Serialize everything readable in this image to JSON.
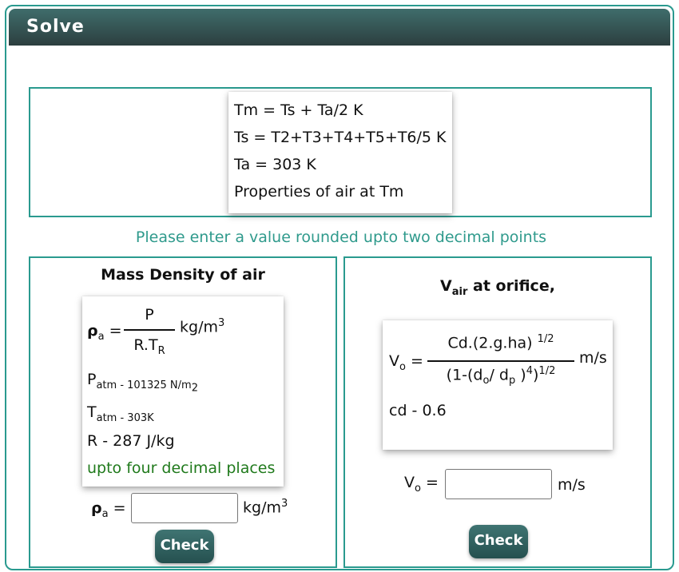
{
  "header": {
    "title": "Solve"
  },
  "formulas": {
    "line1": "Tm = Ts + Ta/2 K",
    "line2": "Ts = T2+T3+T4+T5+T6/5 K",
    "line3": "Ta = 303 K",
    "line4": "Properties of air at Tm"
  },
  "instruction": "Please enter a value rounded upto two decimal points",
  "left_panel": {
    "title": "Mass Density of air",
    "rho_symbol": "ρ",
    "rho_sub": "a",
    "equals": "=",
    "num": "P",
    "den_main": "R.T",
    "den_sub": "R",
    "unit_main": "kg/m",
    "unit_sup": "3",
    "patm_main": "P",
    "patm_sub": "atm - 101325 N/m",
    "patm_sub2": "2",
    "tatm_main": "T",
    "tatm_sub": "atm - 303K",
    "r_line": "R - 287 J/kg",
    "note": "upto four decimal places",
    "input_label_symbol": "ρ",
    "input_label_sub": "a",
    "input_label_eq": "=",
    "input_unit": "kg/m",
    "input_unit_sup": "3",
    "input_value": "",
    "check_label": "Check"
  },
  "right_panel": {
    "title_main": "V",
    "title_sub": "air",
    "title_rest": " at orifice,",
    "vo_main": "V",
    "vo_sub": "o",
    "equals": "=",
    "num": "Cd.(2.g.ha)",
    "num_sup": "1/2",
    "den_a": "(1-(d",
    "den_sub_o": "o",
    "den_b": "/ d",
    "den_sub_p": "p",
    "den_c": ")",
    "den_sup4": "4",
    "den_d": ")",
    "den_sup": "1/2",
    "unit": "m/s",
    "cd_line": "cd - 0.6",
    "input_label_main": "V",
    "input_label_sub": "o",
    "input_label_eq": "=",
    "input_unit": "m/s",
    "input_value": "",
    "check_label": "Check"
  },
  "colors": {
    "accent": "#2a9a8f",
    "instruction": "#2f9a8c",
    "note": "#207a1c",
    "header_top": "#3f6d6b",
    "header_bottom": "#2c3e3f"
  }
}
